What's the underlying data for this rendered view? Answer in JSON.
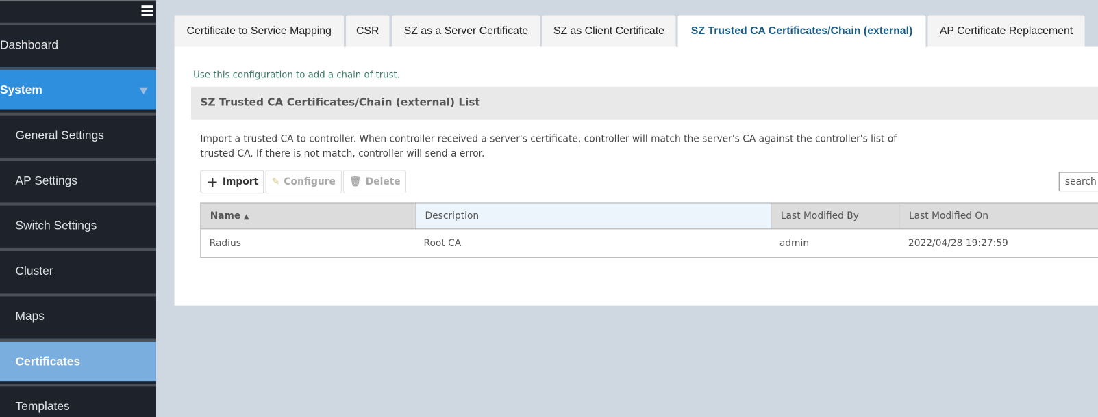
{
  "sidebar": {
    "items": [
      {
        "label": "Dashboard"
      },
      {
        "label": "System"
      },
      {
        "label": "General Settings"
      },
      {
        "label": "AP Settings"
      },
      {
        "label": "Switch Settings"
      },
      {
        "label": "Cluster"
      },
      {
        "label": "Maps"
      },
      {
        "label": "Certificates"
      },
      {
        "label": "Templates"
      }
    ],
    "selected": "Certificates",
    "accent": "#2f8fdf"
  },
  "tabs": [
    {
      "label": "Certificate to Service Mapping"
    },
    {
      "label": "CSR"
    },
    {
      "label": "SZ as a Server Certificate"
    },
    {
      "label": "SZ as Client Certificate"
    },
    {
      "label": "SZ Trusted CA Certificates/Chain (external)"
    },
    {
      "label": "AP Certificate Replacement"
    }
  ],
  "active_tab": "SZ Trusted CA Certificates/Chain (external)",
  "hint": "Use this configuration to add a chain of trust.",
  "list_title": "SZ Trusted CA Certificates/Chain (external) List",
  "description": "Import a trusted CA to controller. When controller received a server's certificate, controller will match the server's CA against the controller's list of trusted CA. If there is not match, controller will send a error.",
  "toolbar": {
    "import": "Import",
    "configure": "Configure",
    "delete": "Delete"
  },
  "search": {
    "placeholder": "search"
  },
  "table": {
    "columns": [
      "Name",
      "Description",
      "Last Modified By",
      "Last Modified On"
    ],
    "rows": [
      [
        "Radius",
        "Root CA",
        "admin",
        "2022/04/28 19:27:59"
      ]
    ]
  }
}
